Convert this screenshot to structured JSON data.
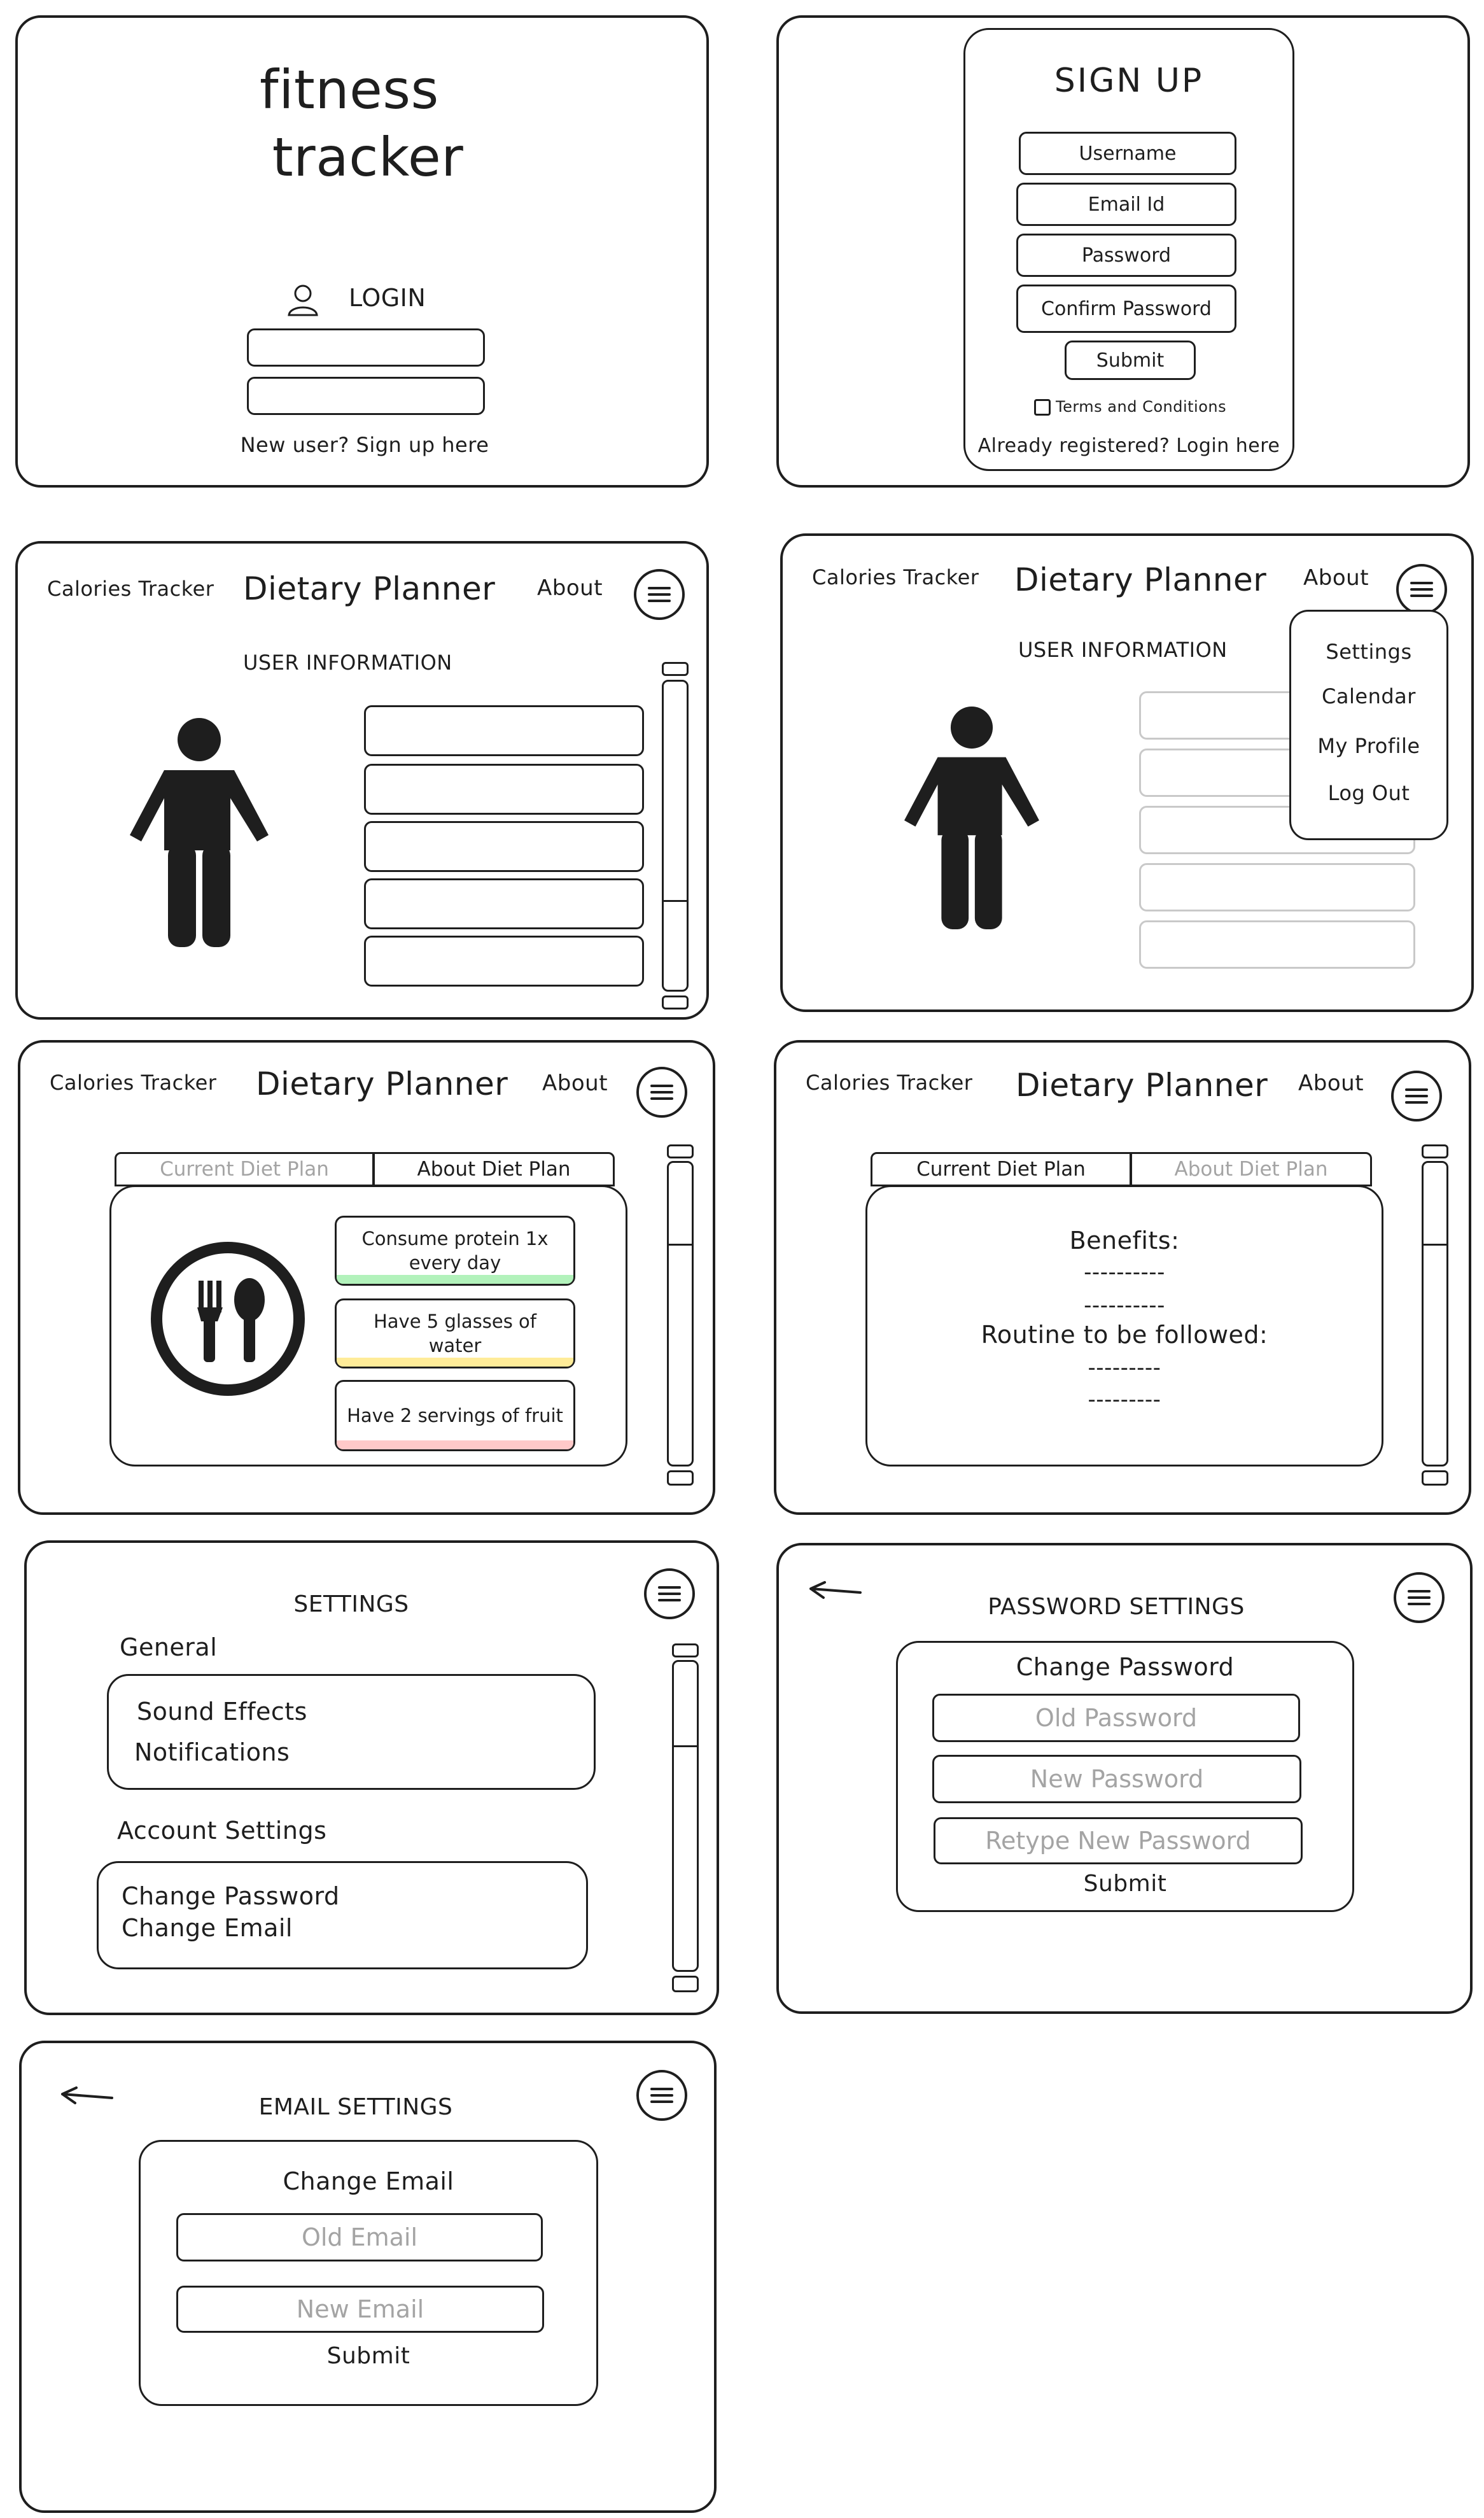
{
  "colors": {
    "stroke": "#1e1e1e",
    "ghost": "#c9c9c9",
    "muted": "#a4a4a4",
    "green": "#b2f2bb",
    "yellow": "#ffec99",
    "red": "#ffc9c9"
  },
  "login": {
    "title_line1": "fitness",
    "title_line2": "tracker",
    "login_label": "LOGIN",
    "signup_link": "New user? Sign up here",
    "icon": "user-icon"
  },
  "signup": {
    "title": "SIGN UP",
    "username": "Username",
    "email": "Email Id",
    "password": "Password",
    "confirm": "Confirm Password",
    "submit": "Submit",
    "terms": "Terms and Conditions",
    "login_link": "Already registered? Login here"
  },
  "nav": {
    "calories": "Calories Tracker",
    "title": "Dietary Planner",
    "about": "About",
    "menu_icon": "hamburger-menu-icon"
  },
  "profile": {
    "heading": "USER INFORMATION",
    "avatar": "person-icon"
  },
  "dropdown": {
    "items": [
      "Settings",
      "Calendar",
      "My Profile",
      "Log Out"
    ]
  },
  "diet": {
    "tab_current": "Current Diet Plan",
    "tab_about": "About Diet Plan",
    "plate_icon": "plate-cutlery-icon",
    "cards": [
      "Consume protein 1x every day",
      "Have 5 glasses of water",
      "Have 2 servings of fruit"
    ]
  },
  "about": {
    "benefits": "Benefits:",
    "dash1": "----------",
    "dash2": "----------",
    "routine": "Routine to be followed:",
    "dash3": "---------",
    "dash4": "---------"
  },
  "settings": {
    "title": "SETTINGS",
    "general": "General",
    "sound": "Sound Effects",
    "notifications": "Notifications",
    "account": "Account Settings",
    "change_password": "Change Password",
    "change_email": "Change Email"
  },
  "password_settings": {
    "title": "PASSWORD SETTINGS",
    "heading": "Change Password",
    "old": "Old Password",
    "new": "New Password",
    "retype": "Retype New Password",
    "submit": "Submit"
  },
  "email_settings": {
    "title": "EMAIL SETTINGS",
    "heading": "Change Email",
    "old": "Old Email",
    "new": "New Email",
    "submit": "Submit"
  }
}
